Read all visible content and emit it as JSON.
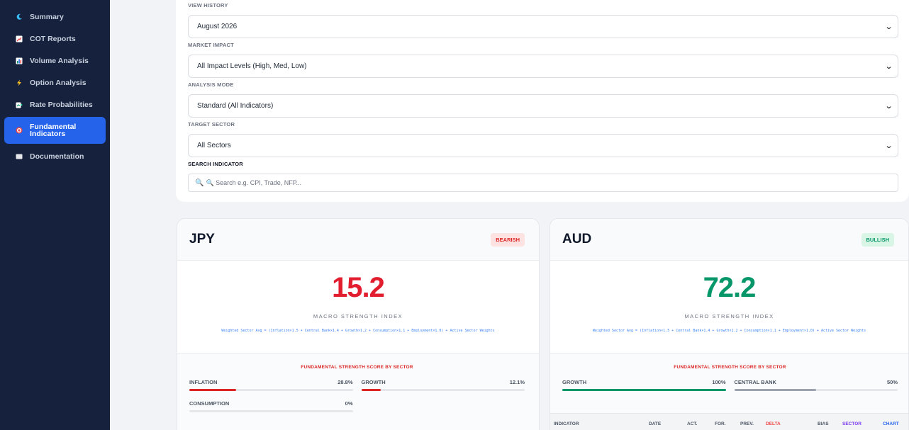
{
  "sidebar": {
    "items": [
      {
        "label": "Summary",
        "icon": "moon-icon",
        "color": "#38bdf8"
      },
      {
        "label": "COT Reports",
        "icon": "chart-up-icon",
        "color": "#f87171"
      },
      {
        "label": "Volume Analysis",
        "icon": "bar-chart-icon",
        "color": "#fbbf24"
      },
      {
        "label": "Option Analysis",
        "icon": "lightning-icon",
        "color": "#fbbf24"
      },
      {
        "label": "Rate Probabilities",
        "icon": "trend-chart-icon",
        "color": "#34d399"
      },
      {
        "label": "Fundamental\nIndicators",
        "icon": "target-icon",
        "color": "#ef4444"
      },
      {
        "label": "Documentation",
        "icon": "document-icon",
        "color": "#e5e7eb"
      }
    ],
    "active_index": 5
  },
  "filters": {
    "view_history": {
      "label": "VIEW HISTORY",
      "value": "August 2026"
    },
    "market_impact": {
      "label": "MARKET IMPACT",
      "value": "All Impact Levels (High, Med, Low)"
    },
    "analysis_mode": {
      "label": "ANALYSIS MODE",
      "value": "Standard (All Indicators)"
    },
    "target_sector": {
      "label": "TARGET SECTOR",
      "value": "All Sectors"
    },
    "search": {
      "label": "SEARCH INDICATOR",
      "placeholder": "🔍 Search e.g. CPI, Trade, NFP..."
    }
  },
  "cards": {
    "jpy": {
      "currency": "JPY",
      "bias": "BEARISH",
      "score": "15.2",
      "score_label": "MACRO STRENGTH INDEX",
      "formula": "Weighted Sector Avg = (Inflation×1.5 + Central Bank×1.4 + Growth×1.2 + Consumption×1.1 + Employment×1.0) + Active Sector Weights",
      "sector_title": "FUNDAMENTAL STRENGTH SCORE BY SECTOR",
      "sectors": [
        {
          "name": "INFLATION",
          "pct": "28.8%",
          "value": 28.8,
          "color": "#dc2626"
        },
        {
          "name": "GROWTH",
          "pct": "12.1%",
          "value": 12.1,
          "color": "#dc2626"
        },
        {
          "name": "CONSUMPTION",
          "pct": "0%",
          "value": 0,
          "color": "#dc2626"
        }
      ]
    },
    "aud": {
      "currency": "AUD",
      "bias": "BULLISH",
      "score": "72.2",
      "score_label": "MACRO STRENGTH INDEX",
      "formula": "Weighted Sector Avg = (Inflation×1.5 + Central Bank×1.4 + Growth×1.2 + Consumption×1.1 + Employment×1.0) + Active Sector Weights",
      "sector_title": "FUNDAMENTAL STRENGTH SCORE BY SECTOR",
      "sectors": [
        {
          "name": "GROWTH",
          "pct": "100%",
          "value": 100,
          "color": "#059669"
        },
        {
          "name": "CENTRAL BANK",
          "pct": "50%",
          "value": 50,
          "color": "#9ca3af"
        }
      ],
      "table_headers": {
        "indicator": "INDICATOR",
        "date": "DATE",
        "act": "ACT.",
        "for": "FOR.",
        "prev": "PREV.",
        "delta": "DELTA",
        "bias": "BIAS",
        "sector": "SECTOR",
        "chart": "CHART"
      }
    }
  },
  "colors": {
    "accent": "#2563eb",
    "bearish": "#e11d2e",
    "bullish": "#059669",
    "sidebar": "#16213e"
  }
}
